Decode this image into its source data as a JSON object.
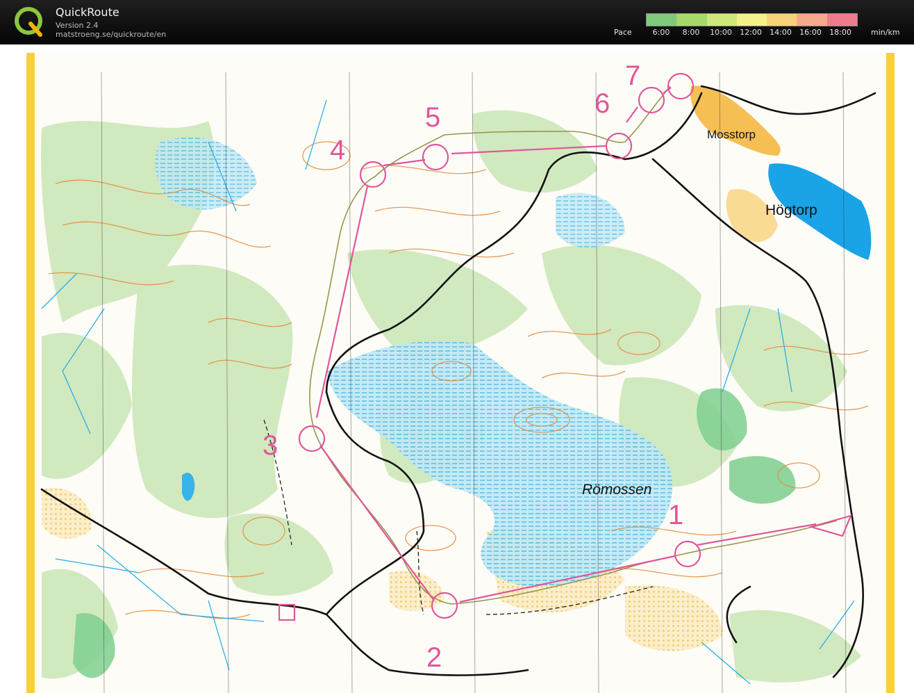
{
  "app": {
    "title": "QuickRoute",
    "version": "Version 2.4",
    "url": "matstroeng.se/quickroute/en",
    "logo_letter": "Q",
    "logo_icon": "quickroute-logo-icon"
  },
  "pace_legend": {
    "label": "Pace",
    "unit": "min/km",
    "ticks": [
      "6:00",
      "8:00",
      "10:00",
      "12:00",
      "14:00",
      "16:00",
      "18:00"
    ],
    "colors": [
      "#7fc97a",
      "#a6d96a",
      "#cfe87a",
      "#f4f08a",
      "#f8d27a",
      "#f6a98a",
      "#f07b8c"
    ]
  },
  "map": {
    "place_names": [
      "Mosstorp",
      "Högtorp",
      "Römossen"
    ],
    "controls": [
      "1",
      "2",
      "3",
      "4",
      "5",
      "6",
      "7"
    ],
    "colors": {
      "course": "#e0569a",
      "water": "#2aaee6",
      "marsh": "#7fd3ea",
      "forest": "#bfe1a8",
      "contour": "#e07a2e",
      "open": "#f6c544",
      "route": "#8c8a3a",
      "road": "#111111"
    }
  }
}
